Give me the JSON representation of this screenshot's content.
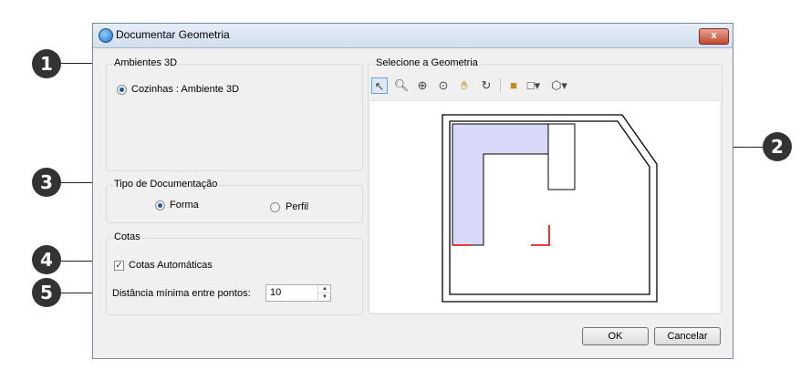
{
  "window": {
    "title": "Documentar Geometria",
    "close_label": "x"
  },
  "callouts": [
    "1",
    "2",
    "3",
    "4",
    "5"
  ],
  "ambientes": {
    "legend": "Ambientes 3D",
    "item_label": "Cozinhas : Ambiente 3D",
    "item_selected": true
  },
  "tipo": {
    "legend": "Tipo de Documentação",
    "forma_label": "Forma",
    "perfil_label": "Perfil",
    "selected": "Forma"
  },
  "cotas": {
    "legend": "Cotas",
    "auto_label": "Cotas Automáticas",
    "auto_checked": true,
    "distance_label": "Distância mínima entre pontos:",
    "distance_value": "10"
  },
  "geometria": {
    "legend": "Selecione a Geometria",
    "toolbar_icons": [
      "select-arrow-icon",
      "zoom-realtime-icon",
      "zoom-in-icon",
      "zoom-window-icon",
      "pan-hand-icon",
      "orbit-icon",
      "shaded-view-icon",
      "wireframe-view-icon",
      "view-cube-icon"
    ]
  },
  "buttons": {
    "ok": "OK",
    "cancel": "Cancelar"
  },
  "colors": {
    "highlight_fill": "#d8d8f8",
    "marker_red": "#e00000",
    "close_red": "#c24a33"
  }
}
